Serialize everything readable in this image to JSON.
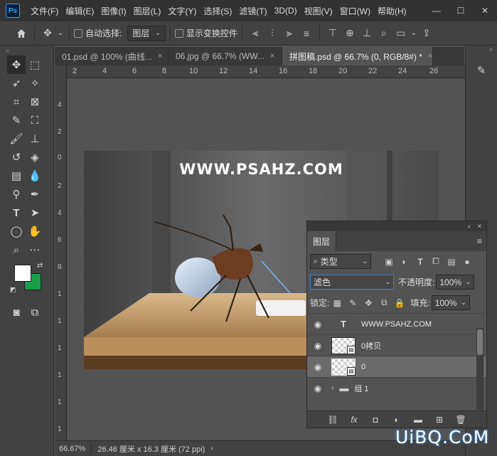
{
  "app": {
    "logo": "Ps"
  },
  "menubar": {
    "items": [
      "文件(F)",
      "编辑(E)",
      "图像(I)",
      "图层(L)",
      "文字(Y)",
      "选择(S)",
      "滤镜(T)",
      "3D(D)",
      "视图(V)",
      "窗口(W)",
      "帮助(H)"
    ]
  },
  "window_controls": {
    "minimize": "—",
    "maximize": "☐",
    "close": "✕"
  },
  "options": {
    "auto_select_label": "自动选择:",
    "auto_select_target": "图层",
    "show_transform_label": "显示变换控件"
  },
  "tabs": [
    {
      "label": "01.psd @ 100% (曲线...",
      "close": "×"
    },
    {
      "label": "06.jpg @ 66.7% (WW...",
      "close": "×"
    },
    {
      "label": "拼图稿.psd @ 66.7% (0, RGB/8#) *",
      "close": "×"
    }
  ],
  "ruler": {
    "h_ticks": [
      "2",
      "4",
      "6",
      "8",
      "10",
      "12",
      "14",
      "16",
      "18",
      "20",
      "22",
      "24",
      "26"
    ],
    "v_ticks": [
      "4",
      "2",
      "0",
      "2",
      "4",
      "6",
      "8",
      "1",
      "1",
      "1",
      "1",
      "1",
      "1"
    ]
  },
  "canvas": {
    "title": "WWW.PSAHZ.COM"
  },
  "status": {
    "zoom": "66.67%",
    "doc_size": "26.46 厘米 x 16.3 厘米 (72 ppi)"
  },
  "layers_panel": {
    "tab_label": "图层",
    "filter_kind": "类型",
    "blend_mode": "滤色",
    "opacity_label": "不透明度:",
    "opacity_value": "100%",
    "lock_label": "锁定:",
    "fill_label": "填充:",
    "fill_value": "100%",
    "layers": [
      {
        "name": "WWW.PSAHZ.COM",
        "type": "text"
      },
      {
        "name": "0拷贝",
        "type": "image"
      },
      {
        "name": "0",
        "type": "image"
      },
      {
        "name": "组 1",
        "type": "group"
      }
    ]
  },
  "watermark": {
    "text": "UiBQ.CoM"
  },
  "colors": {
    "foreground": "#ffffff",
    "background": "#1a9e4b",
    "accent": "#31a8ff"
  }
}
